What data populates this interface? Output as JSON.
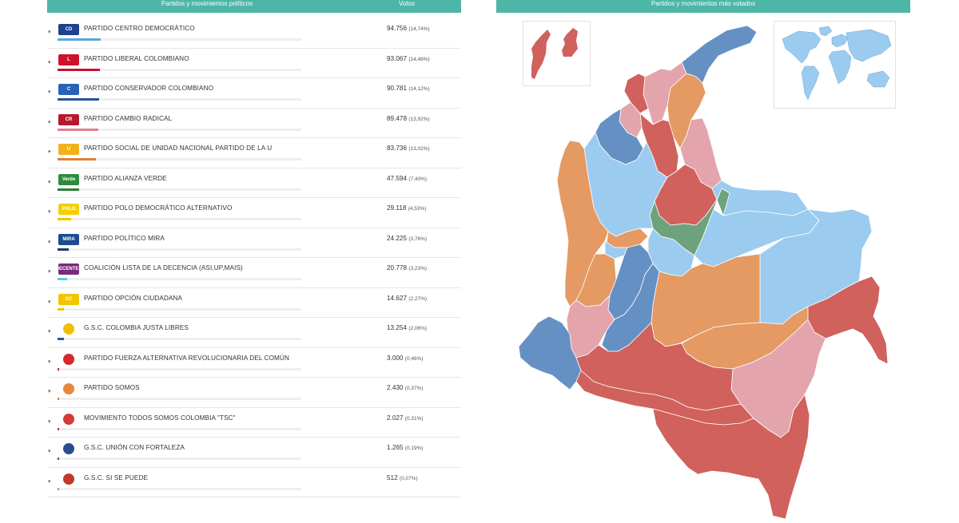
{
  "left_header": {
    "col_party": "Partidos y movimientos políticos",
    "col_votes": "Votos"
  },
  "right_header": {
    "title": "Partidos y movimientos más votados"
  },
  "colors": {
    "header": "#4db6a6",
    "map_red": "#d0615c",
    "map_blue": "#6590c4",
    "map_lightblue": "#9ccbf0",
    "map_orange": "#e49a62",
    "map_pink": "#e4a4ab",
    "map_green": "#6ea27c"
  },
  "parties": [
    {
      "name": "PARTIDO CENTRO DEMOCRÁTICO",
      "votes": "94.756",
      "pct": "(14,74%)",
      "share": 14.74,
      "color": "#58a6dd",
      "logo_text": "CD",
      "logo_bg": "#1f3f8f",
      "icon": "centro-democratico-logo-icon"
    },
    {
      "name": "PARTIDO LIBERAL COLOMBIANO",
      "votes": "93.067",
      "pct": "(14,48%)",
      "share": 14.48,
      "color": "#c8102e",
      "logo_text": "L",
      "logo_bg": "#d0112b",
      "icon": "partido-liberal-logo-icon"
    },
    {
      "name": "PARTIDO CONSERVADOR COLOMBIANO",
      "votes": "90.781",
      "pct": "(14,12%)",
      "share": 14.12,
      "color": "#27539a",
      "logo_text": "C",
      "logo_bg": "#2a62b8",
      "icon": "partido-conservador-logo-icon"
    },
    {
      "name": "PARTIDO CAMBIO RADICAL",
      "votes": "89.478",
      "pct": "(13,92%)",
      "share": 13.92,
      "color": "#e07f8c",
      "logo_text": "CR",
      "logo_bg": "#b5192f",
      "icon": "cambio-radical-logo-icon"
    },
    {
      "name": "PARTIDO SOCIAL DE UNIDAD NACIONAL PARTIDO DE LA U",
      "votes": "83.736",
      "pct": "(13,02%)",
      "share": 13.02,
      "color": "#e1802f",
      "logo_text": "U",
      "logo_bg": "#f2b21b",
      "icon": "partido-de-la-u-logo-icon"
    },
    {
      "name": "PARTIDO ALIANZA VERDE",
      "votes": "47.594",
      "pct": "(7,40%)",
      "share": 7.4,
      "color": "#2f7f3a",
      "logo_text": "Verde",
      "logo_bg": "#2e8b3d",
      "icon": "alianza-verde-logo-icon"
    },
    {
      "name": "PARTIDO POLO DEMOCRÁTICO ALTERNATIVO",
      "votes": "29.118",
      "pct": "(4,53%)",
      "share": 4.53,
      "color": "#f2c500",
      "logo_text": "POLO",
      "logo_bg": "#f3d000",
      "icon": "polo-democratico-logo-icon"
    },
    {
      "name": "PARTIDO POLÍTICO MIRA",
      "votes": "24.225",
      "pct": "(3,76%)",
      "share": 3.76,
      "color": "#1f3a66",
      "logo_text": "MIRA",
      "logo_bg": "#1e4a8f",
      "icon": "mira-logo-icon"
    },
    {
      "name": "COALICIÓN LISTA DE LA DECENCIA (ASI,UP,MAIS)",
      "votes": "20.778",
      "pct": "(3,23%)",
      "share": 3.23,
      "color": "#5cc8e6",
      "logo_text": "DECENTES",
      "logo_bg": "#7a2a7d",
      "icon": "lista-decencia-logo-icon"
    },
    {
      "name": "PARTIDO OPCIÓN CIUDADANA",
      "votes": "14.627",
      "pct": "(2,27%)",
      "share": 2.27,
      "color": "#f2c000",
      "logo_text": "OC",
      "logo_bg": "#f3c400",
      "icon": "opcion-ciudadana-logo-icon"
    },
    {
      "name": "G.S.C. COLOMBIA JUSTA LIBRES",
      "votes": "13.254",
      "pct": "(2,06%)",
      "share": 2.06,
      "color": "#2f4ea6",
      "logo_text": "",
      "logo_bg": "#f0c000",
      "icon": "colombia-justa-libres-logo-icon"
    },
    {
      "name": "PARTIDO FUERZA ALTERNATIVA REVOLUCIONARIA DEL COMÚN",
      "votes": "3.000",
      "pct": "(0,46%)",
      "share": 0.46,
      "color": "#b02a6a",
      "logo_text": "",
      "logo_bg": "#d6262b",
      "icon": "farc-rose-logo-icon"
    },
    {
      "name": "PARTIDO SOMOS",
      "votes": "2.430",
      "pct": "(0,37%)",
      "share": 0.37,
      "color": "#e07a2b",
      "logo_text": "",
      "logo_bg": "#e58a3c",
      "icon": "partido-somos-logo-icon"
    },
    {
      "name": "MOVIMIENTO TODOS SOMOS COLOMBIA \"TSC\"",
      "votes": "2.027",
      "pct": "(0,31%)",
      "share": 0.31,
      "color": "#c0392b",
      "logo_text": "",
      "logo_bg": "#d33a3a",
      "icon": "todos-somos-colombia-logo-icon"
    },
    {
      "name": "G.S.C. UNIÓN CON FORTALEZA",
      "votes": "1.265",
      "pct": "(0,19%)",
      "share": 0.19,
      "color": "#555555",
      "logo_text": "",
      "logo_bg": "#2b4c8c",
      "icon": "union-con-fortaleza-logo-icon"
    },
    {
      "name": "G.S.C. SI SE PUEDE",
      "votes": "512",
      "pct": "(0,07%)",
      "share": 0.07,
      "color": "#999999",
      "logo_text": "",
      "logo_bg": "#c0392b",
      "icon": "si-se-puede-logo-icon"
    }
  ]
}
